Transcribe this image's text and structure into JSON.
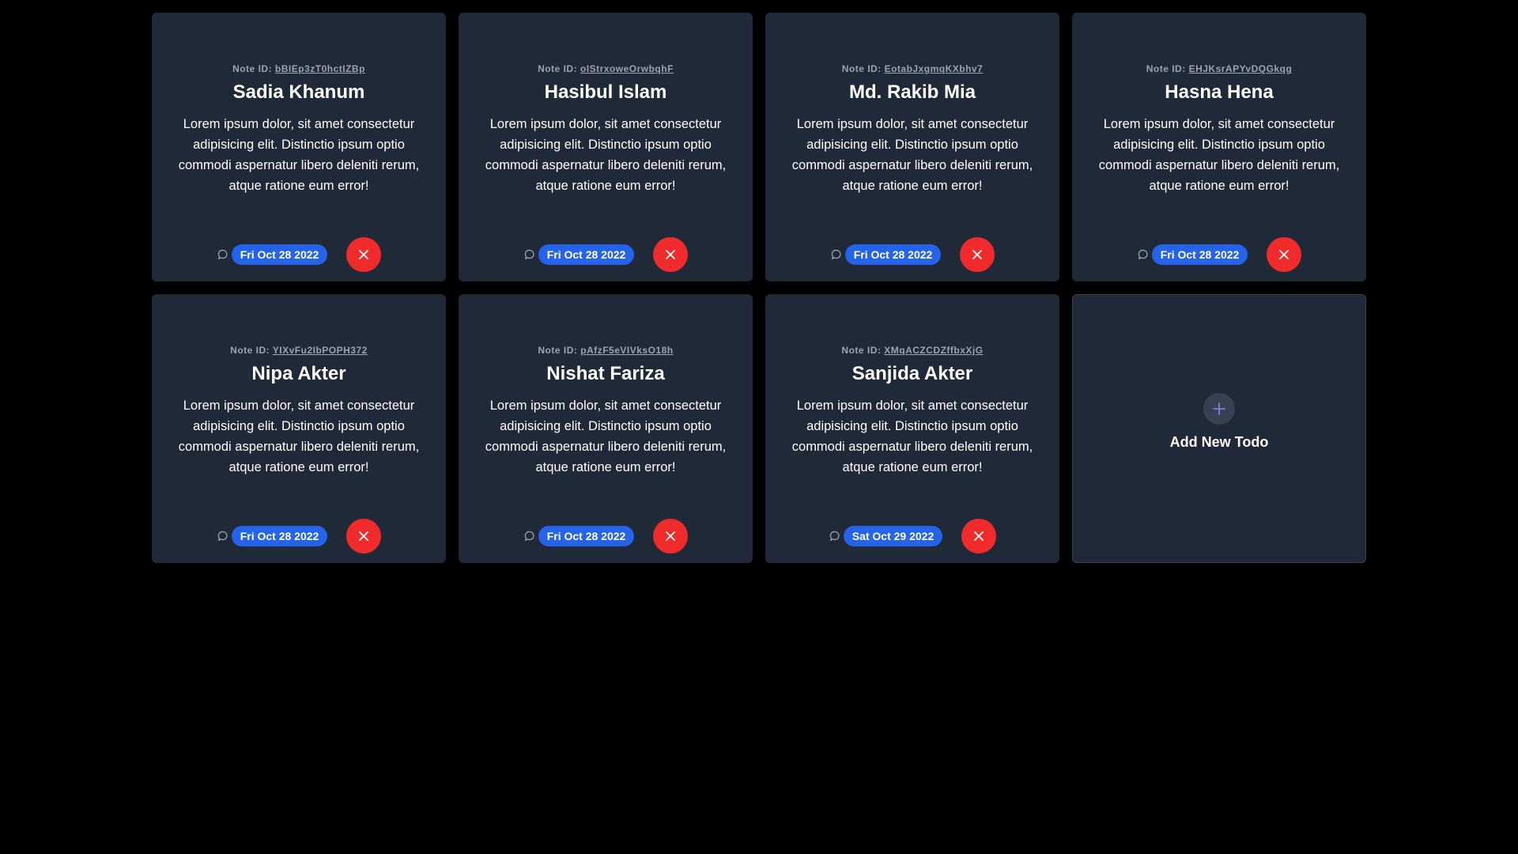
{
  "notes": [
    {
      "id_prefix": "Note ID:",
      "id": "bBIEp3zT0hctIZBp",
      "name": "Sadia Khanum",
      "body": "Lorem ipsum dolor, sit amet consectetur adipisicing elit. Distinctio ipsum optio commodi aspernatur libero deleniti rerum, atque ratione eum error!",
      "date": "Fri Oct 28 2022"
    },
    {
      "id_prefix": "Note ID:",
      "id": "oIStrxoweOrwbqhF",
      "name": "Hasibul Islam",
      "body": "Lorem ipsum dolor, sit amet consectetur adipisicing elit. Distinctio ipsum optio commodi aspernatur libero deleniti rerum, atque ratione eum error!",
      "date": "Fri Oct 28 2022"
    },
    {
      "id_prefix": "Note ID:",
      "id": "EotabJxgmqKXbhv7",
      "name": "Md. Rakib Mia",
      "body": "Lorem ipsum dolor, sit amet consectetur adipisicing elit. Distinctio ipsum optio commodi aspernatur libero deleniti rerum, atque ratione eum error!",
      "date": "Fri Oct 28 2022"
    },
    {
      "id_prefix": "Note ID:",
      "id": "EHJKsrAPYvDQGkqg",
      "name": "Hasna Hena",
      "body": "Lorem ipsum dolor, sit amet consectetur adipisicing elit. Distinctio ipsum optio commodi aspernatur libero deleniti rerum, atque ratione eum error!",
      "date": "Fri Oct 28 2022"
    },
    {
      "id_prefix": "Note ID:",
      "id": "YIXvFu2IbPOPH372",
      "name": "Nipa Akter",
      "body": "Lorem ipsum dolor, sit amet consectetur adipisicing elit. Distinctio ipsum optio commodi aspernatur libero deleniti rerum, atque ratione eum error!",
      "date": "Fri Oct 28 2022"
    },
    {
      "id_prefix": "Note ID:",
      "id": "pAfzF5eVIVksO18h",
      "name": "Nishat Fariza",
      "body": "Lorem ipsum dolor, sit amet consectetur adipisicing elit. Distinctio ipsum optio commodi aspernatur libero deleniti rerum, atque ratione eum error!",
      "date": "Fri Oct 28 2022"
    },
    {
      "id_prefix": "Note ID:",
      "id": "XMqACZCDZffbxXjG",
      "name": "Sanjida Akter",
      "body": "Lorem ipsum dolor, sit amet consectetur adipisicing elit. Distinctio ipsum optio commodi aspernatur libero deleniti rerum, atque ratione eum error!",
      "date": "Sat Oct 29 2022"
    }
  ],
  "add_card": {
    "label": "Add New Todo",
    "icon": "plus-icon"
  },
  "colors": {
    "page_bg": "#000000",
    "card_bg": "#1f2937",
    "date_badge": "#2563eb",
    "delete_button": "#ef2b2b",
    "plus_accent": "#818cf8"
  },
  "icons": {
    "comment": "comment-icon",
    "delete": "close-icon"
  }
}
